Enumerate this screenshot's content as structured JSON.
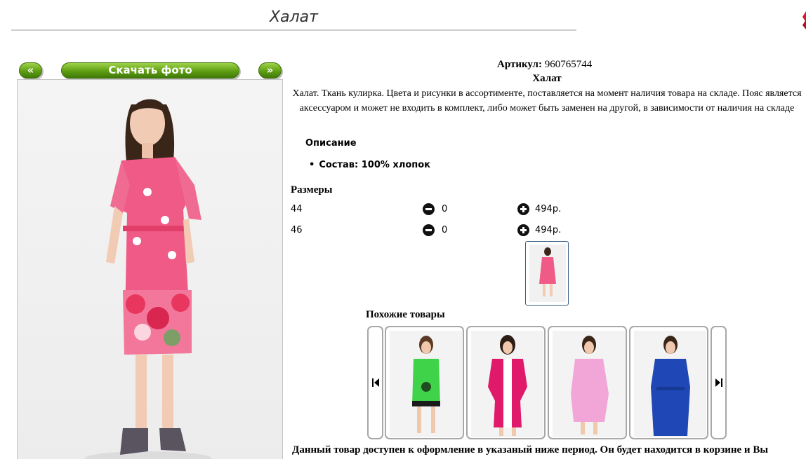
{
  "page": {
    "title": "Халат"
  },
  "toolbar": {
    "prev_label": "«",
    "download_label": "Скачать фото",
    "next_label": "»"
  },
  "product": {
    "article_label": "Артикул:",
    "article_value": " 960765744",
    "name": "Халат",
    "description": "Халат. Ткань кулирка. Цвета и рисунки в ассортименте, поставляется на момент наличия товара на складе. Пояс является аксессуаром и может не входить в комплект, либо может быть заменен на другой, в зависимости от наличия на складе",
    "description_heading": "Описание",
    "composition": "Состав: 100% хлопок"
  },
  "sizes": {
    "heading": "Размеры",
    "rows": [
      {
        "size": "44",
        "qty": "0",
        "price": "494р."
      },
      {
        "size": "46",
        "qty": "0",
        "price": "494р."
      }
    ]
  },
  "similar": {
    "heading": "Похожие товары"
  },
  "footer": {
    "availability_text": "Данный товар доступен к оформление в указаный ниже период. Он будет находится в корзине и Вы"
  },
  "colors": {
    "button_green": "#5f9e12",
    "dress_pink": "#ef5a86",
    "green_dress": "#3fd34a",
    "fuchsia_vest": "#e0196a",
    "light_pink_robe": "#f2a6d8",
    "blue_robe": "#1f47b5"
  },
  "icons": [
    "minus-circle-icon",
    "plus-circle-icon",
    "carousel-left-icon",
    "carousel-right-icon"
  ]
}
